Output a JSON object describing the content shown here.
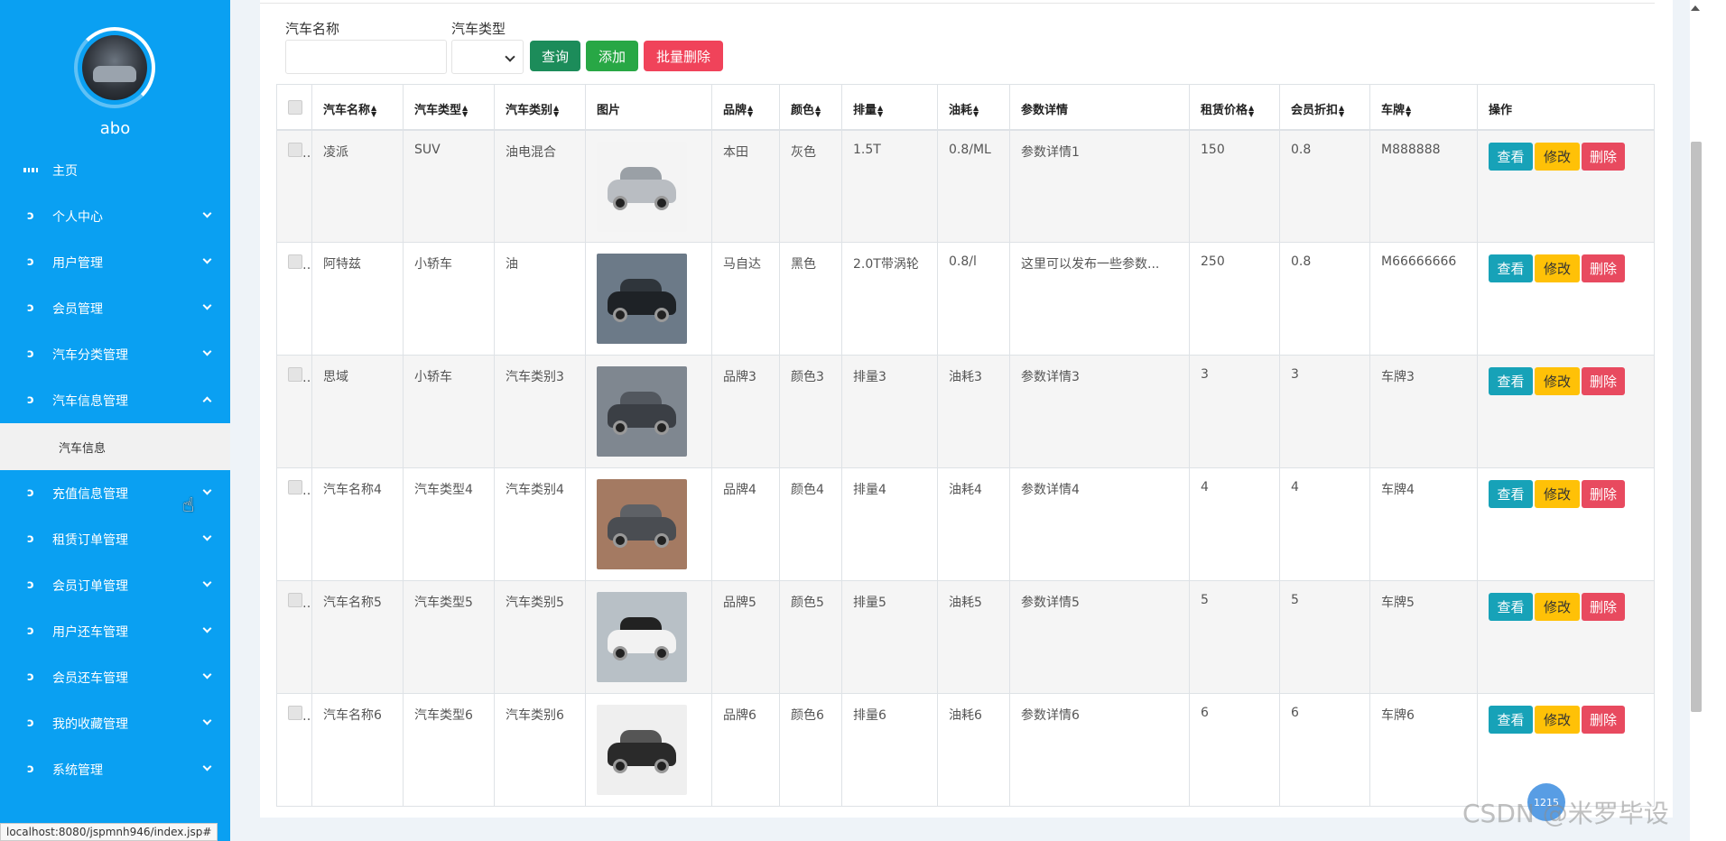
{
  "sidebar": {
    "username": "abo",
    "items": [
      {
        "label": "主页",
        "icon": "dashboard-icon"
      },
      {
        "label": "个人中心",
        "icon": "menu-icon"
      },
      {
        "label": "用户管理",
        "icon": "menu-icon"
      },
      {
        "label": "会员管理",
        "icon": "menu-icon"
      },
      {
        "label": "汽车分类管理",
        "icon": "menu-icon"
      },
      {
        "label": "汽车信息管理",
        "icon": "menu-icon"
      },
      {
        "label": "充值信息管理",
        "icon": "menu-icon"
      },
      {
        "label": "租赁订单管理",
        "icon": "menu-icon"
      },
      {
        "label": "会员订单管理",
        "icon": "menu-icon"
      },
      {
        "label": "用户还车管理",
        "icon": "menu-icon"
      },
      {
        "label": "会员还车管理",
        "icon": "menu-icon"
      },
      {
        "label": "我的收藏管理",
        "icon": "menu-icon"
      },
      {
        "label": "系统管理",
        "icon": "menu-icon"
      }
    ],
    "submenu_label": "汽车信息"
  },
  "search": {
    "name_label": "汽车名称",
    "type_label": "汽车类型",
    "name_value": "",
    "query_btn": "查询",
    "add_btn": "添加",
    "batch_delete_btn": "批量删除"
  },
  "table": {
    "headers": [
      "汽车名称",
      "汽车类型",
      "汽车类别",
      "图片",
      "品牌",
      "颜色",
      "排量",
      "油耗",
      "参数详情",
      "租赁价格",
      "会员折扣",
      "车牌",
      "操作"
    ],
    "sortable": [
      true,
      true,
      true,
      false,
      true,
      true,
      true,
      true,
      false,
      true,
      true,
      true,
      false
    ],
    "rows": [
      {
        "name": "凌派",
        "type": "SUV",
        "category": "油电混合",
        "brand": "本田",
        "color": "灰色",
        "displacement": "1.5T",
        "fuel": "0.8/ML",
        "details": "参数详情1",
        "price": "150",
        "discount": "0.8",
        "plate": "M888888"
      },
      {
        "name": "阿特兹",
        "type": "小轿车",
        "category": "油",
        "brand": "马自达",
        "color": "黑色",
        "displacement": "2.0T带涡轮",
        "fuel": "0.8/l",
        "details": "这里可以发布一些参数...",
        "price": "250",
        "discount": "0.8",
        "plate": "M66666666"
      },
      {
        "name": "思域",
        "type": "小轿车",
        "category": "汽车类别3",
        "brand": "品牌3",
        "color": "颜色3",
        "displacement": "排量3",
        "fuel": "油耗3",
        "details": "参数详情3",
        "price": "3",
        "discount": "3",
        "plate": "车牌3"
      },
      {
        "name": "汽车名称4",
        "type": "汽车类型4",
        "category": "汽车类别4",
        "brand": "品牌4",
        "color": "颜色4",
        "displacement": "排量4",
        "fuel": "油耗4",
        "details": "参数详情4",
        "price": "4",
        "discount": "4",
        "plate": "车牌4"
      },
      {
        "name": "汽车名称5",
        "type": "汽车类型5",
        "category": "汽车类别5",
        "brand": "品牌5",
        "color": "颜色5",
        "displacement": "排量5",
        "fuel": "油耗5",
        "details": "参数详情5",
        "price": "5",
        "discount": "5",
        "plate": "车牌5"
      },
      {
        "name": "汽车名称6",
        "type": "汽车类型6",
        "category": "汽车类别6",
        "brand": "品牌6",
        "color": "颜色6",
        "displacement": "排量6",
        "fuel": "油耗6",
        "details": "参数详情6",
        "price": "6",
        "discount": "6",
        "plate": "车牌6"
      }
    ],
    "actions": {
      "view": "查看",
      "edit": "修改",
      "delete": "删除"
    }
  },
  "statusbar": {
    "url": "localhost:8080/jspmnh946/index.jsp#"
  },
  "overlay": {
    "badge": "1215",
    "watermark": "CSDN @米罗毕设"
  },
  "colors": {
    "sidebar": "#0aa0f2",
    "query": "#1c8c5a",
    "add": "#28a745",
    "batch_delete": "#f0435a",
    "view": "#17a2b8",
    "edit": "#ffc107",
    "delete": "#e84a5f"
  }
}
